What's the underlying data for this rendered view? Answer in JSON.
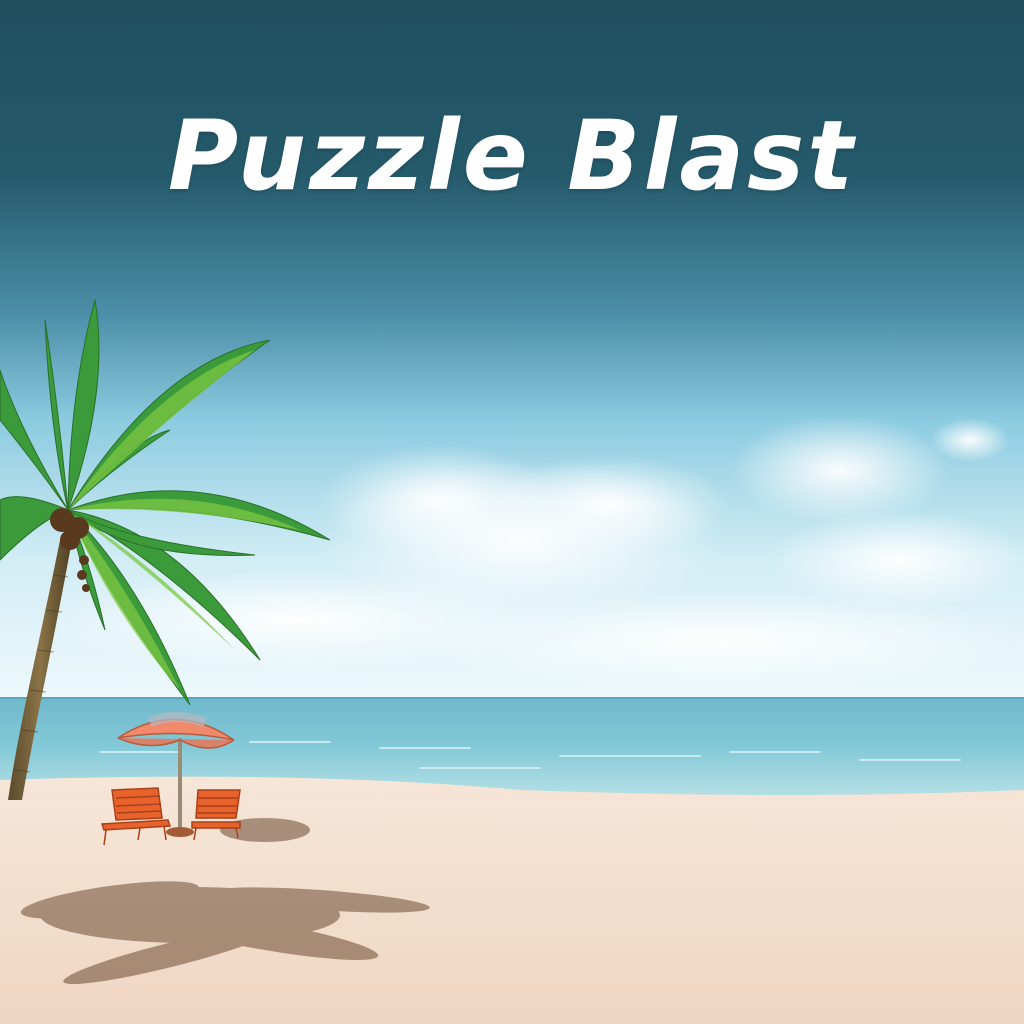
{
  "game": {
    "title": "Puzzle Blast"
  },
  "scene": {
    "elements": [
      "sky",
      "clouds",
      "sea",
      "beach",
      "palm-tree",
      "beach-umbrella",
      "deck-chairs"
    ]
  },
  "colors": {
    "sky_top": "#1f4f5d",
    "sky_mid": "#4c8fa8",
    "sky_horizon": "#e6f6fb",
    "sea": "#7cc4d4",
    "sand": "#f3dccb",
    "palm_leaf": "#3b9a3a",
    "chair": "#e8632c",
    "umbrella": "#f08a6a",
    "title_text": "#ffffff"
  }
}
